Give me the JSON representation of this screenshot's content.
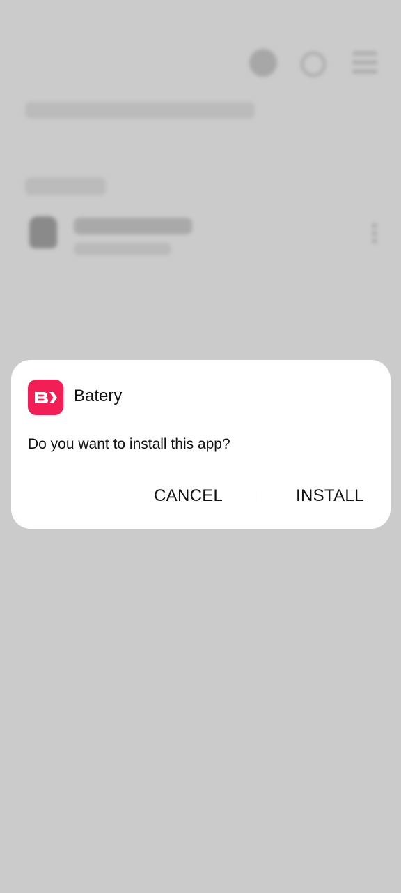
{
  "dialog": {
    "app_name": "Batery",
    "app_icon": "batery-logo-icon",
    "message": "Do you want to install this app?",
    "cancel_label": "CANCEL",
    "install_label": "INSTALL"
  },
  "colors": {
    "scrim": "#cbcbcb",
    "dialog_background": "#ffffff",
    "app_icon_background": "#f21f56"
  }
}
